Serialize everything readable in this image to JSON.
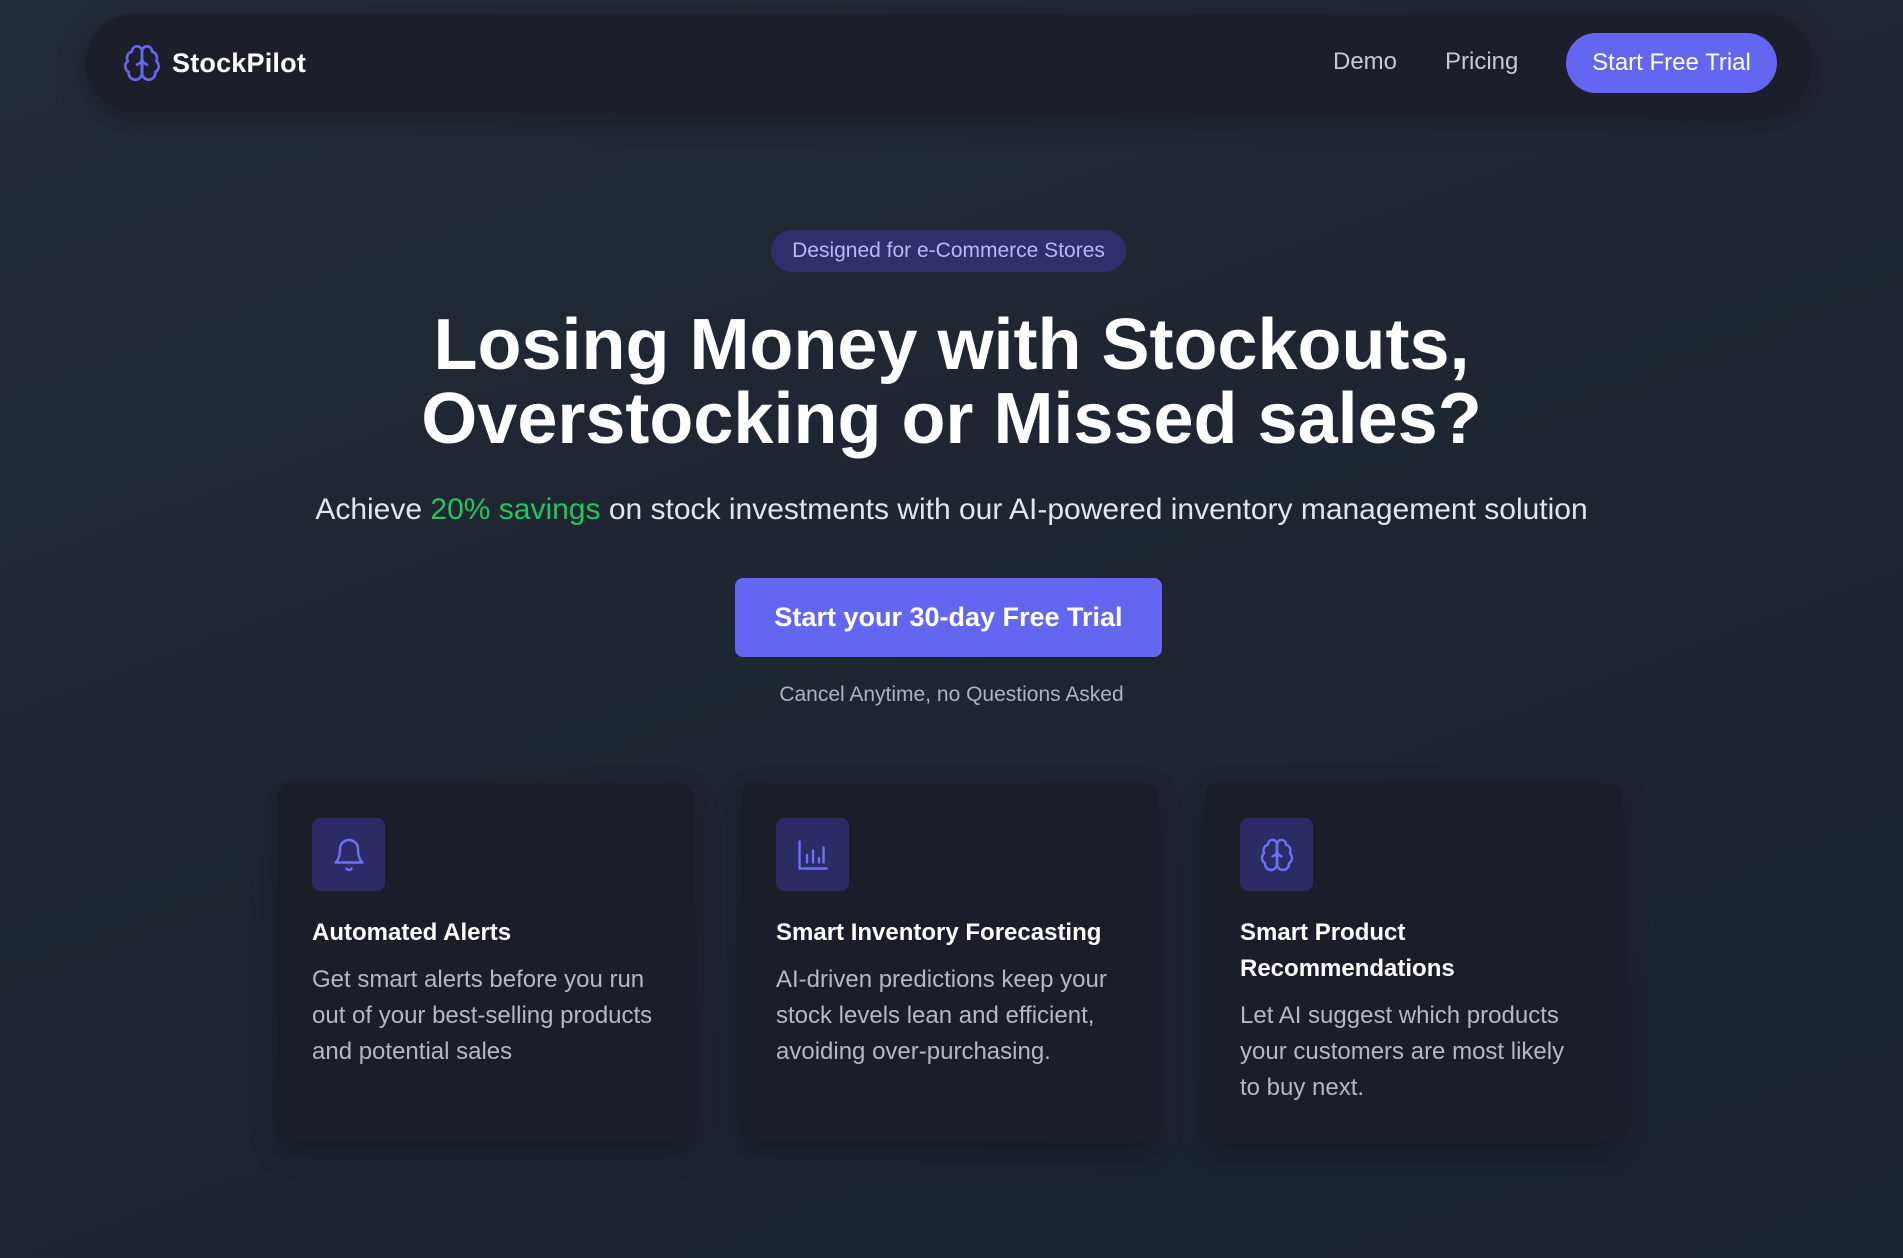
{
  "brand": {
    "name": "StockPilot",
    "icon": "brain-icon"
  },
  "nav": {
    "links": [
      "Demo",
      "Pricing"
    ],
    "cta_label": "Start Free Trial"
  },
  "hero": {
    "badge": "Designed for e-Commerce Stores",
    "headline_line1": "Losing Money with Stockouts,",
    "headline_line2": "Overstocking or Missed sales?",
    "sub_prefix": "Achieve ",
    "sub_highlight": "20% savings",
    "sub_suffix": " on stock investments with our AI-powered inventory management solution",
    "cta_label": "Start your 30-day Free Trial",
    "cancel_note": "Cancel Anytime, no Questions Asked"
  },
  "features": [
    {
      "icon": "bell-icon",
      "title": "Automated Alerts",
      "description": "Get smart alerts before you run out of your best-selling products and potential sales"
    },
    {
      "icon": "bar-chart-icon",
      "title": "Smart Inventory Forecasting",
      "description": "AI-driven predictions keep your stock levels lean and efficient, avoiding over-purchasing."
    },
    {
      "icon": "brain-icon",
      "title": "Smart Product Recommendations",
      "description": "Let AI suggest which products your customers are most likely to buy next."
    }
  ],
  "colors": {
    "accent": "#6366f1",
    "highlight_green": "#22c55e",
    "card_bg": "#1b1d29",
    "icon_tile_bg": "#2d2b66"
  }
}
